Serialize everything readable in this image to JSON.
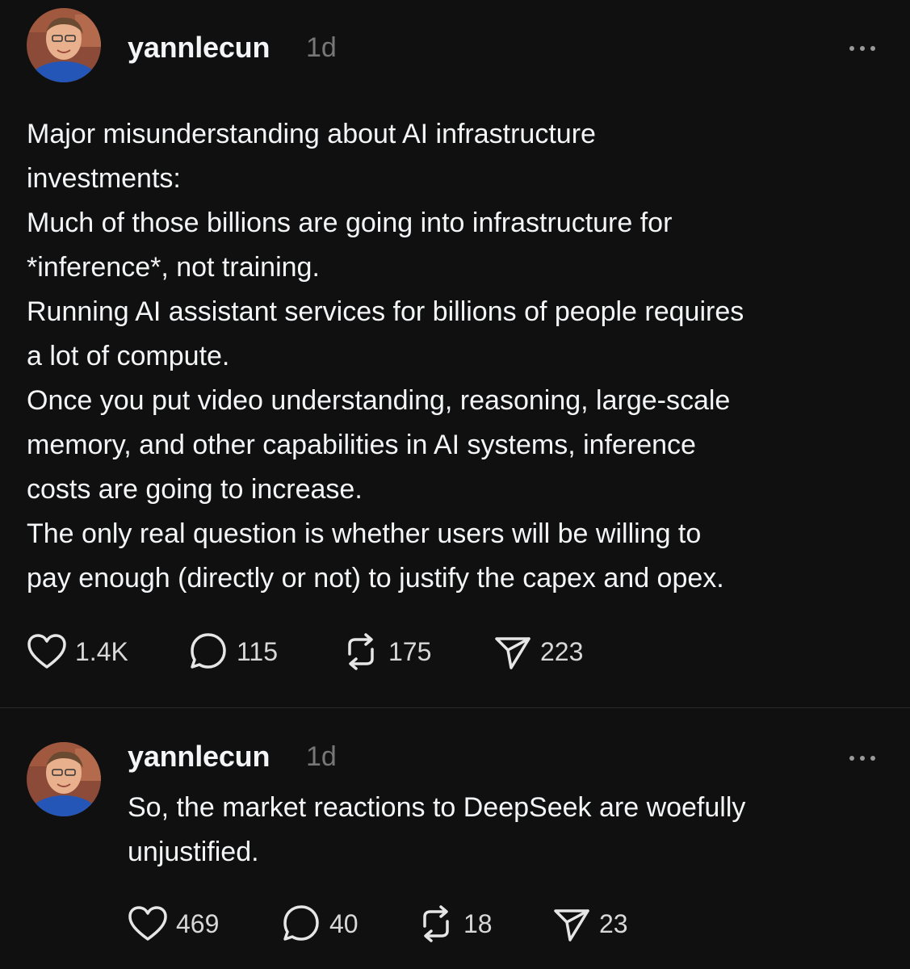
{
  "posts": [
    {
      "username": "yannlecun",
      "time": "1d",
      "lines": [
        "Major misunderstanding about AI infrastructure",
        "investments:",
        "Much of those billions are going into infrastructure for",
        "*inference*, not training.",
        "Running AI assistant services for billions of people requires",
        "a lot of compute.",
        "Once you put video understanding, reasoning, large-scale",
        "memory, and other capabilities in AI systems, inference",
        "costs are going to increase.",
        "The only real question is whether users will be willing to",
        "pay enough (directly or not) to justify the capex and opex."
      ],
      "likes": "1.4K",
      "replies": "115",
      "reposts": "175",
      "shares": "223"
    },
    {
      "username": "yannlecun",
      "time": "1d",
      "lines": [
        "So, the market reactions to DeepSeek are woefully",
        "unjustified."
      ],
      "likes": "469",
      "replies": "40",
      "reposts": "18",
      "shares": "23"
    }
  ],
  "icons": {
    "more": "more-horizontal-icon",
    "like": "heart-icon",
    "reply": "comment-icon",
    "repost": "repost-icon",
    "share": "send-icon"
  },
  "colors": {
    "background": "#101010",
    "text": "#f3f5f7",
    "muted": "#777777"
  }
}
